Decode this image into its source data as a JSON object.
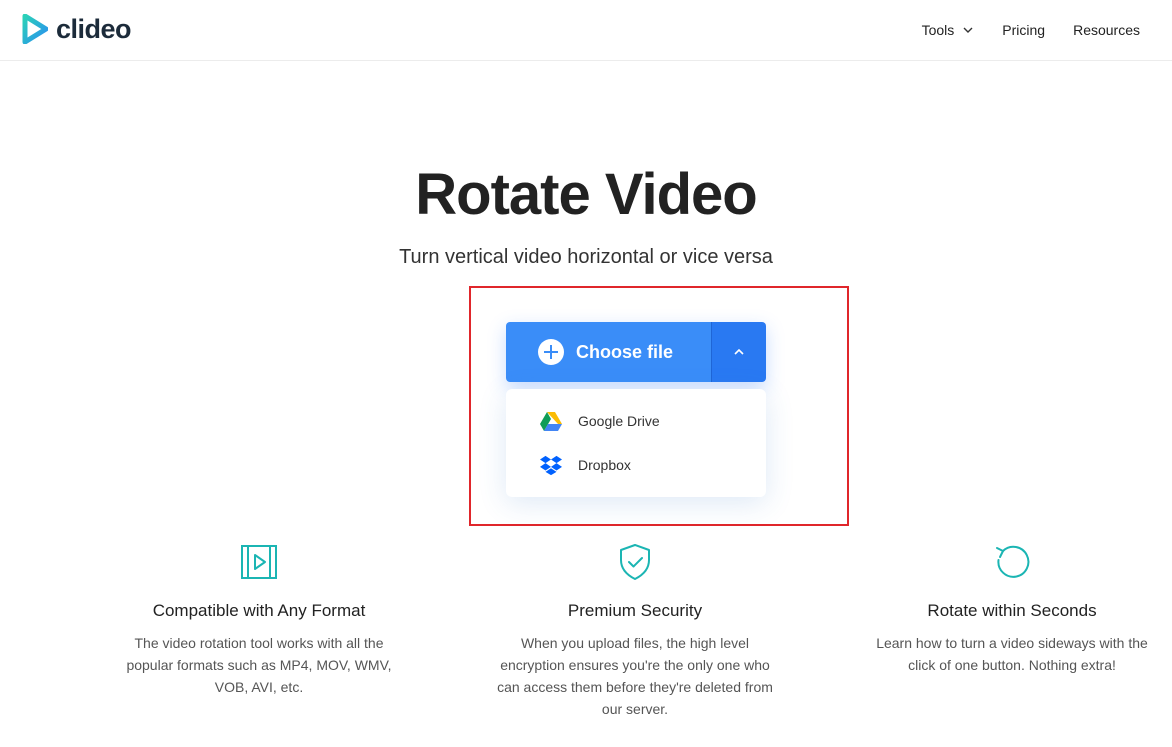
{
  "brand": {
    "name": "clideo",
    "accent": "#3a8df8",
    "logo_teal": "#1bb5b3"
  },
  "nav": {
    "tools": "Tools",
    "pricing": "Pricing",
    "resources": "Resources"
  },
  "hero": {
    "title": "Rotate Video",
    "subtitle": "Turn vertical video horizontal or vice versa"
  },
  "uploader": {
    "choose_label": "Choose file",
    "options": [
      {
        "label": "Google Drive",
        "icon": "google-drive-icon"
      },
      {
        "label": "Dropbox",
        "icon": "dropbox-icon"
      }
    ]
  },
  "features": [
    {
      "icon": "video-format-icon",
      "title": "Compatible with Any Format",
      "desc": "The video rotation tool works with all the popular formats such as MP4, MOV, WMV, VOB, AVI, etc."
    },
    {
      "icon": "shield-check-icon",
      "title": "Premium Security",
      "desc": "When you upload files, the high level encryption ensures you're the only one who can access them before they're deleted from our server."
    },
    {
      "icon": "rotate-icon",
      "title": "Rotate within Seconds",
      "desc": "Learn how to turn a video sideways with the click of one button. Nothing extra!"
    }
  ]
}
